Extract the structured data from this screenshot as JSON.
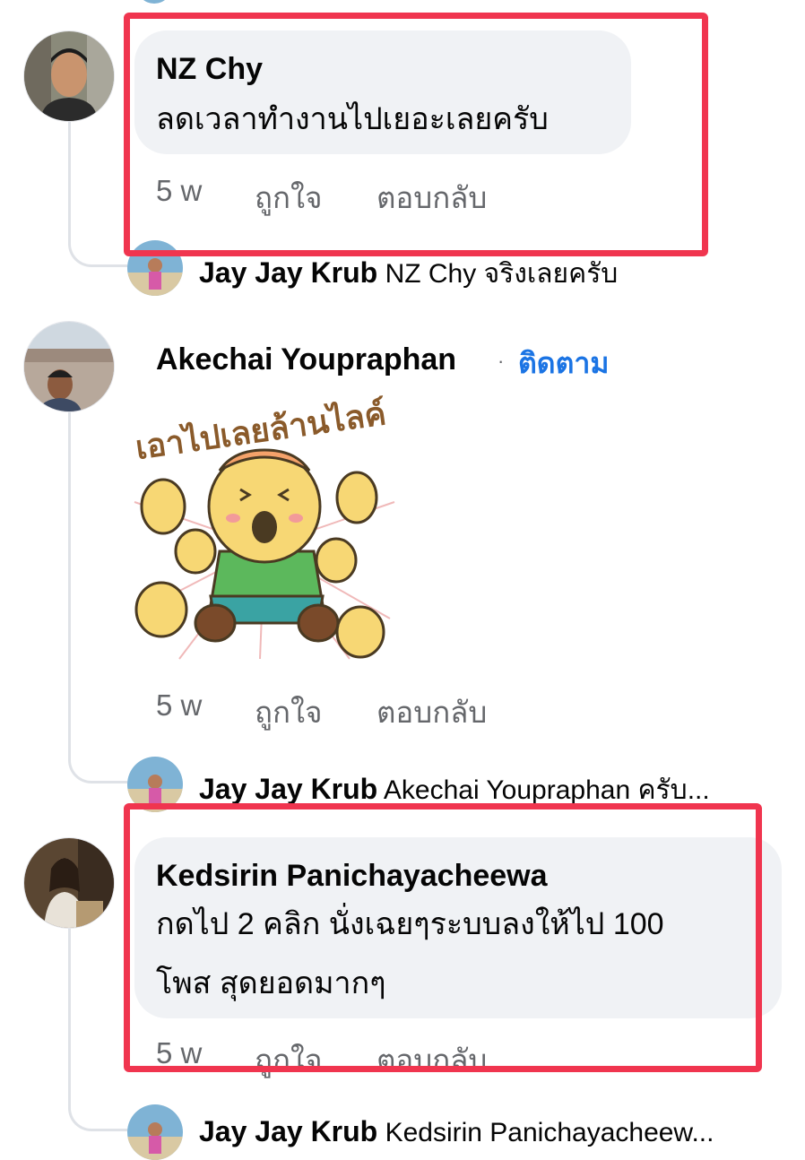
{
  "comments": [
    {
      "author": "NZ Chy",
      "text": "ลดเวลาทำงานไปเยอะเลยครับ",
      "time": "5 w",
      "like": "ถูกใจ",
      "reply": "ตอบกลับ"
    },
    {
      "author": "Akechai Youpraphan",
      "follow": "ติดตาม",
      "separator": "·",
      "sticker_text": "เอาไปเลยล้านไลค์",
      "time": "5 w",
      "like": "ถูกใจ",
      "reply": "ตอบกลับ"
    },
    {
      "author": "Kedsirin Panichayacheewa",
      "text_line1": "กดไป 2 คลิก นั่งเฉยๆระบบลงให้ไป 100",
      "text_line2": "โพส สุดยอดมากๆ",
      "time": "5 w",
      "like": "ถูกใจ",
      "reply": "ตอบกลับ"
    }
  ],
  "replies": [
    {
      "author": "Jay Jay Krub",
      "text": "NZ Chy จริงเลยครับ"
    },
    {
      "author": "Jay Jay Krub",
      "text": "Akechai Youpraphan ครับ..."
    },
    {
      "author": "Jay Jay Krub",
      "text": "Kedsirin Panichayacheew..."
    }
  ],
  "colors": {
    "highlight": "#f0354f",
    "link": "#1b74e4",
    "bubble": "#f0f2f5",
    "meta": "#65676b"
  }
}
